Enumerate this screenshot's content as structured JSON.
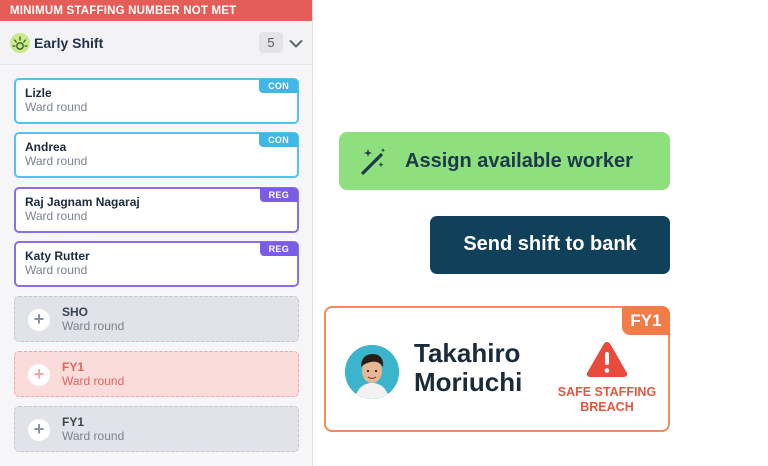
{
  "staffing": {
    "alert": "MINIMUM STAFFING NUMBER NOT MET",
    "shift_title": "Early Shift",
    "count": "5"
  },
  "assigned": [
    {
      "name": "Lizle",
      "task": "Ward round",
      "grade": "CON"
    },
    {
      "name": "Andrea",
      "task": "Ward round",
      "grade": "CON"
    },
    {
      "name": "Raj Jagnam Nagaraj",
      "task": "Ward round",
      "grade": "REG"
    },
    {
      "name": "Katy Rutter",
      "task": "Ward round",
      "grade": "REG"
    }
  ],
  "open_slots": [
    {
      "grade": "SHO",
      "task": "Ward round"
    },
    {
      "grade": "FY1",
      "task": "Ward round"
    },
    {
      "grade": "FY1",
      "task": "Ward round"
    }
  ],
  "actions": {
    "assign_label": "Assign available worker",
    "bank_label": "Send shift to bank"
  },
  "worker": {
    "grade": "FY1",
    "first_name": "Takahiro",
    "last_name": "Moriuchi",
    "warning_line1": "SAFE STAFFING",
    "warning_line2": "BREACH"
  },
  "colors": {
    "alert": "#e45d58",
    "con": "#3fb8e6",
    "reg": "#7b5de3",
    "assign": "#8ee07e",
    "bank": "#11405a",
    "breach": "#e5563f",
    "fy1_tag": "#f27b47"
  },
  "icons": {
    "shift": "sun-icon",
    "expand": "chevron-down-icon",
    "add": "plus-icon",
    "assign": "magic-wand-icon",
    "warning": "warning-triangle-icon"
  }
}
